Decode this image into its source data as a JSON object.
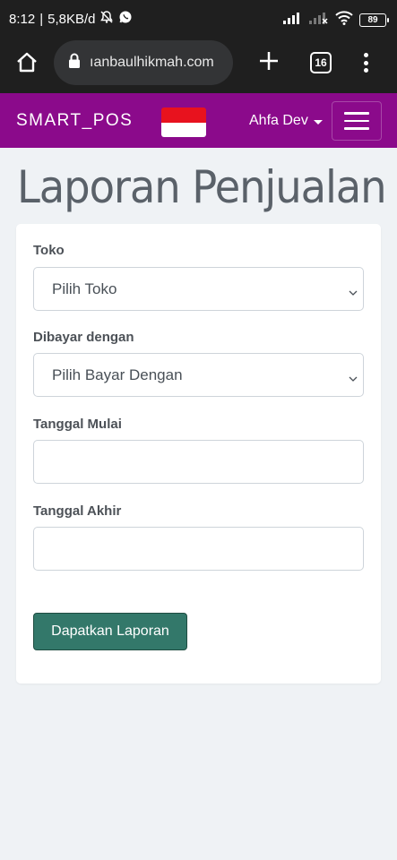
{
  "status_bar": {
    "time": "8:12",
    "separator": "|",
    "network_speed": "5,8KB/d",
    "battery_level": "89",
    "icons": [
      "bell-muted-icon",
      "whatsapp-icon",
      "signal-icon",
      "signal-no-service-icon",
      "wifi-icon",
      "battery-icon"
    ]
  },
  "browser": {
    "url": "ananbaulhikmah.com",
    "url_visible": "ıanbaulhikmah.com",
    "tab_count": "16",
    "icons": [
      "home-icon",
      "lock-icon",
      "plus-icon",
      "tabs-icon",
      "more-vert-icon"
    ]
  },
  "navbar": {
    "brand": "SMART_POS",
    "flag": "indonesia-flag",
    "user_name": "Ahfa Dev",
    "background": "#8b0a8b"
  },
  "page": {
    "title": "Laporan Penjualan"
  },
  "form": {
    "toko_label": "Toko",
    "toko_selected": "Pilih Toko",
    "bayar_label": "Dibayar dengan",
    "bayar_selected": "Pilih Bayar Dengan",
    "mulai_label": "Tanggal Mulai",
    "mulai_value": "",
    "akhir_label": "Tanggal Akhir",
    "akhir_value": "",
    "submit_label": "Dapatkan Laporan",
    "submit_color": "#33786a"
  }
}
